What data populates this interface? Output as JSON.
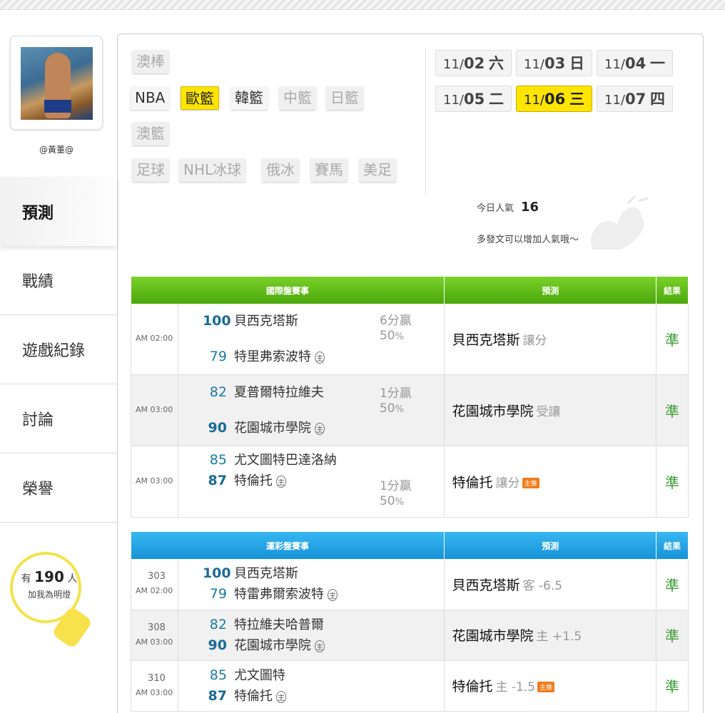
{
  "user": {
    "name": "@黃董@"
  },
  "nav": [
    {
      "label": "預測",
      "active": true
    },
    {
      "label": "戰績"
    },
    {
      "label": "遊戲紀錄"
    },
    {
      "label": "討論"
    },
    {
      "label": "榮譽"
    }
  ],
  "followers": {
    "prefix": "有",
    "count": "190",
    "suffix": "人",
    "caption": "加我為明燈"
  },
  "leagues": {
    "row1": [
      "澳棒"
    ],
    "row2": [
      "NBA",
      "歐籃",
      "韓籃",
      "中籃",
      "日籃"
    ],
    "row3": [
      "澳籃"
    ],
    "row4": [
      "足球",
      "NHL冰球",
      "俄冰",
      "賽馬",
      "美足"
    ],
    "selected": "歐籃"
  },
  "dates": [
    {
      "md": "11/",
      "d": "02",
      "w": "六"
    },
    {
      "md": "11/",
      "d": "03",
      "w": "日"
    },
    {
      "md": "11/",
      "d": "04",
      "w": "一"
    },
    {
      "md": "11/",
      "d": "05",
      "w": "二"
    },
    {
      "md": "11/",
      "d": "06",
      "w": "三",
      "selected": true
    },
    {
      "md": "11/",
      "d": "07",
      "w": "四"
    }
  ],
  "popularity": {
    "label": "今日人氣",
    "value": "16",
    "tip": "多發文可以增加人氣哦～"
  },
  "intl_table": {
    "headers": [
      "國際盤賽事",
      "預測",
      "結果"
    ],
    "rows": [
      {
        "time": "AM 02:00",
        "s1": "100",
        "t1": "貝西克塔斯",
        "s2": "79",
        "t2": "特里弗索波特",
        "home": "主",
        "spread": "6分贏",
        "pct": "50",
        "pct_unit": "%",
        "pred": "貝西克塔斯",
        "pred_sub": "讓分",
        "result": "準"
      },
      {
        "time": "AM 03:00",
        "s1": "82",
        "t1": "夏普爾特拉維夫",
        "s2": "90",
        "t2": "花園城市學院",
        "home": "主",
        "spread": "1分贏",
        "pct": "50",
        "pct_unit": "%",
        "pred": "花園城市學院",
        "pred_sub": "受讓",
        "result": "準"
      },
      {
        "time": "AM 03:00",
        "s1": "85",
        "t1": "尤文圖特巴達洛納",
        "s2": "87",
        "t2": "特倫托",
        "home": "主",
        "spread": "1分贏",
        "pct": "50",
        "pct_unit": "%",
        "pred": "特倫托",
        "pred_sub": "讓分",
        "badge": "主推",
        "result": "準"
      }
    ]
  },
  "lottery_table": {
    "headers": [
      "運彩盤賽事",
      "預測",
      "結果"
    ],
    "rows": [
      {
        "no": "303",
        "time": "AM 02:00",
        "s1": "100",
        "t1": "貝西克塔斯",
        "s2": "79",
        "t2": "特雷弗爾索波特",
        "home": "主",
        "pred": "貝西克塔斯",
        "pred_sub": "客 -6.5",
        "result": "準"
      },
      {
        "no": "308",
        "time": "AM 03:00",
        "s1": "82",
        "t1": "特拉維夫哈普爾",
        "s2": "90",
        "t2": "花園城市學院",
        "home": "主",
        "pred": "花園城市學院",
        "pred_sub": "主 +1.5",
        "result": "準"
      },
      {
        "no": "310",
        "time": "AM 03:00",
        "s1": "85",
        "t1": "尤文圖特",
        "s2": "87",
        "t2": "特倫托",
        "home": "主",
        "pred": "特倫托",
        "pred_sub": "主 -1.5",
        "badge": "主推",
        "result": "準"
      }
    ]
  }
}
